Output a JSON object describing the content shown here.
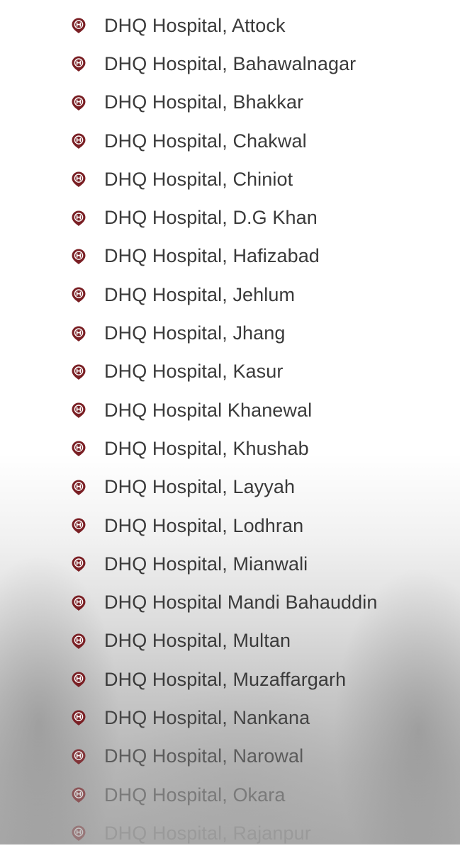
{
  "marker_icon": "hospital-pin-icon",
  "marker_color": "#7a1f24",
  "hospitals": [
    "DHQ Hospital, Attock",
    "DHQ Hospital, Bahawalnagar",
    "DHQ Hospital, Bhakkar",
    "DHQ Hospital, Chakwal",
    "DHQ Hospital, Chiniot",
    "DHQ Hospital, D.G Khan",
    "DHQ Hospital, Hafizabad",
    "DHQ Hospital, Jehlum",
    "DHQ Hospital, Jhang",
    "DHQ Hospital, Kasur",
    "DHQ Hospital Khanewal",
    "DHQ Hospital, Khushab",
    "DHQ Hospital, Layyah",
    "DHQ Hospital, Lodhran",
    "DHQ Hospital, Mianwali",
    "DHQ Hospital Mandi Bahauddin",
    "DHQ Hospital, Multan",
    "DHQ Hospital, Muzaffargarh",
    "DHQ Hospital, Nankana",
    "DHQ Hospital, Narowal",
    "DHQ Hospital, Okara",
    "DHQ Hospital, Rajanpur"
  ]
}
